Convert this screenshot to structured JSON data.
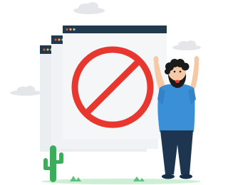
{
  "illustration": {
    "subject": "blocked-access",
    "windows": [
      {
        "role": "back-window",
        "dots": [
          "#e74c3c",
          "#f5b041",
          "#bdc3c7"
        ]
      },
      {
        "role": "middle-window",
        "dots": [
          "#e74c3c",
          "#f5b041",
          "#bdc3c7"
        ]
      },
      {
        "role": "front-window",
        "dots": [
          "#e74c3c",
          "#f5b041",
          "#bdc3c7"
        ]
      }
    ],
    "icons": [
      "prohibited-sign-icon",
      "cactus-icon",
      "cloud-icon",
      "character-illustration"
    ],
    "colors": {
      "window_header": "#1f3a4d",
      "window_body": "#f4f6f8",
      "window_shadow": "#e2e6ea",
      "prohibited_red": "#e8372e",
      "shirt_blue": "#3a8fd6",
      "pants_navy": "#1e3550",
      "skin": "#f6c9a6",
      "hair": "#1b1b1b",
      "cactus_green": "#3cae5b",
      "ground_green": "#cdefd6",
      "cloud_grey": "#e4e6e9"
    }
  }
}
